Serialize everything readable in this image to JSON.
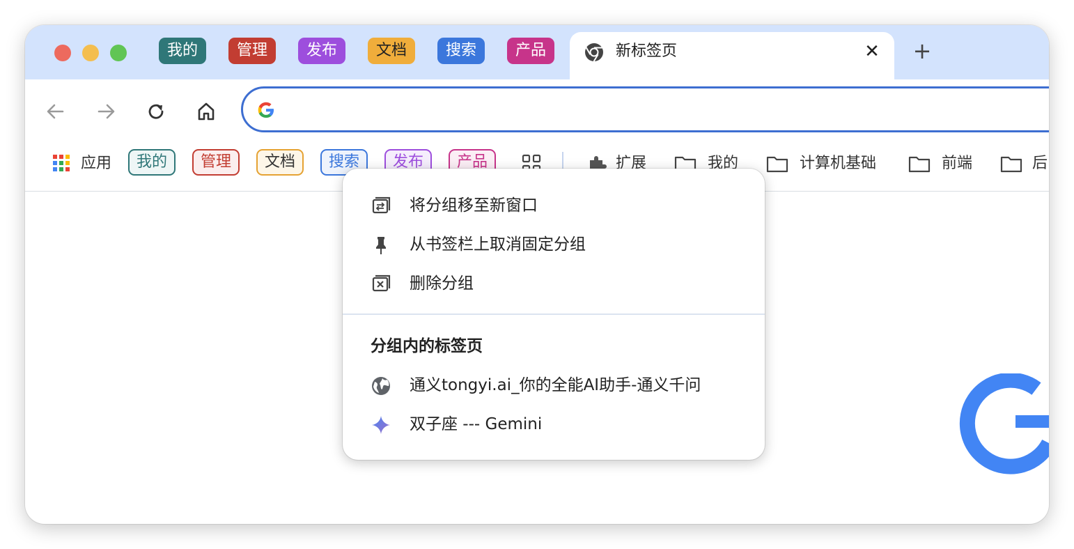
{
  "window": {
    "tab_groups": [
      {
        "label": "我的",
        "color": "#2f7778"
      },
      {
        "label": "管理",
        "color": "#c23d32"
      },
      {
        "label": "发布",
        "color": "#9d4edd"
      },
      {
        "label": "文档",
        "color": "#f0ad3b"
      },
      {
        "label": "搜索",
        "color": "#3b77dc"
      },
      {
        "label": "产品",
        "color": "#c7348a"
      }
    ],
    "active_tab": {
      "title": "新标签页",
      "close": "✕"
    },
    "new_tab": "+"
  },
  "omnibox": {
    "value": "",
    "placeholder": ""
  },
  "bookmarks": {
    "apps": "应用",
    "groups": [
      {
        "label": "我的",
        "color": "#2f7778"
      },
      {
        "label": "管理",
        "color": "#c23d32"
      },
      {
        "label": "文档",
        "color": "#e5a232"
      },
      {
        "label": "搜索",
        "color": "#3b77dc"
      },
      {
        "label": "发布",
        "color": "#9d4edd"
      },
      {
        "label": "产品",
        "color": "#c7348a"
      }
    ],
    "extensions": "扩展",
    "folders": [
      "我的",
      "计算机基础",
      "前端",
      "后"
    ]
  },
  "context_menu": {
    "items": [
      {
        "label": "将分组移至新窗口",
        "icon": "move-to-window-icon"
      },
      {
        "label": "从书签栏上取消固定分组",
        "icon": "pin-icon"
      },
      {
        "label": "删除分组",
        "icon": "delete-group-icon"
      }
    ],
    "section_title": "分组内的标签页",
    "tabs": [
      {
        "label": "通义tongyi.ai_你的全能AI助手-通义千问",
        "icon": "globe-icon"
      },
      {
        "label": "双子座 --- Gemini",
        "icon": "gemini-sparkle-icon"
      }
    ]
  }
}
